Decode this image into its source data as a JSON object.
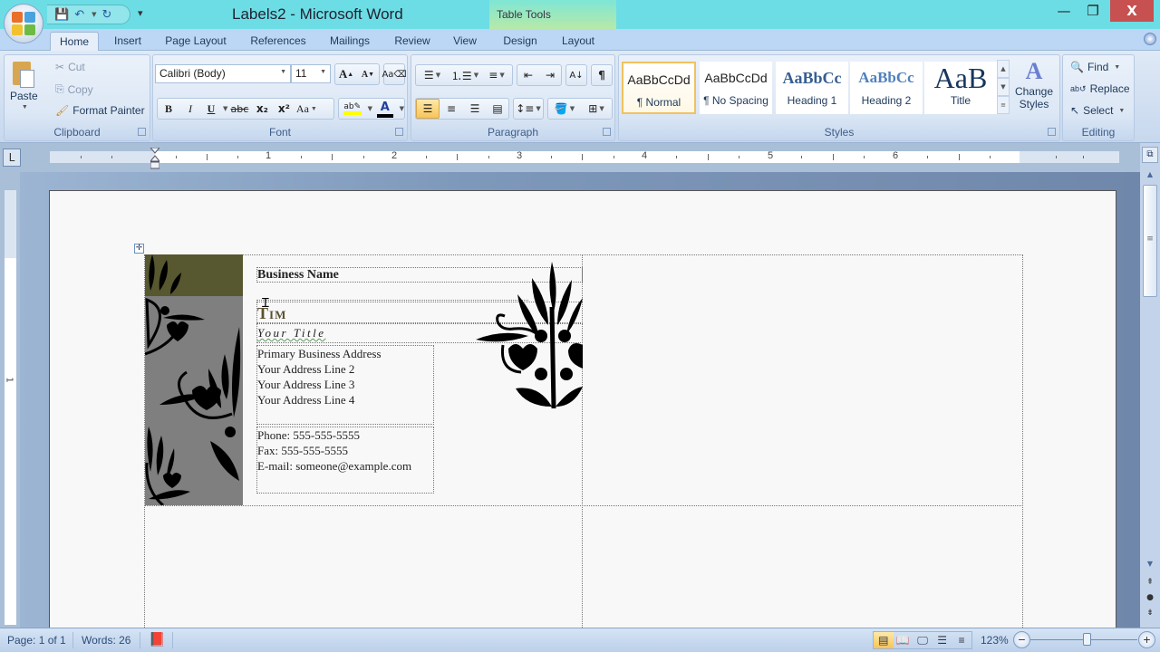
{
  "window": {
    "title": "Labels2 - Microsoft Word",
    "context_tab_group": "Table Tools",
    "minimize_glyph": "—",
    "maximize_glyph": "❐",
    "close_glyph": "X"
  },
  "quick_access": {
    "save_icon": "save-icon",
    "undo_icon": "undo-icon",
    "redo_icon": "redo-icon",
    "customize_glyph": "▾"
  },
  "tabs": [
    {
      "label": "Home",
      "active": true
    },
    {
      "label": "Insert"
    },
    {
      "label": "Page Layout"
    },
    {
      "label": "References"
    },
    {
      "label": "Mailings"
    },
    {
      "label": "Review"
    },
    {
      "label": "View"
    },
    {
      "label": "Design"
    },
    {
      "label": "Layout"
    }
  ],
  "ribbon": {
    "clipboard": {
      "label": "Clipboard",
      "paste": "Paste",
      "cut": "Cut",
      "copy": "Copy",
      "format_painter": "Format Painter"
    },
    "font": {
      "label": "Font",
      "font_name": "Calibri (Body)",
      "font_size": "11",
      "grow_font": "A",
      "shrink_font": "A",
      "bold": "B",
      "italic": "I",
      "underline": "U",
      "strikethrough": "abc",
      "subscript": "x₂",
      "superscript": "x²",
      "change_case": "Aa",
      "highlight_color": "#ffff00",
      "font_color": "#000000"
    },
    "paragraph": {
      "label": "Paragraph",
      "alignment_selected": "left",
      "show_marks": "¶"
    },
    "styles": {
      "label": "Styles",
      "items": [
        {
          "sample": "AaBbCcDd",
          "name": "¶ Normal",
          "selected": true
        },
        {
          "sample": "AaBbCcDd",
          "name": "¶ No Spacing"
        },
        {
          "sample": "AaBbCc",
          "name": "Heading 1"
        },
        {
          "sample": "AaBbCc",
          "name": "Heading 2"
        },
        {
          "sample": "AaB",
          "name": "Title"
        }
      ],
      "change_styles": "Change Styles"
    },
    "editing": {
      "label": "Editing",
      "find": "Find",
      "replace": "Replace",
      "select": "Select"
    }
  },
  "ruler": {
    "tab_selector": "L",
    "numbers": [
      "1",
      "2",
      "3",
      "4",
      "5",
      "6"
    ],
    "vertical_numbers": [
      "1"
    ]
  },
  "document": {
    "business_name": "Business Name",
    "person_name": "Tim",
    "your_title": "Your Title",
    "address_lines": [
      "Primary Business Address",
      "Your Address Line 2",
      "Your Address Line 3",
      "Your Address Line 4"
    ],
    "contact_lines": [
      "Phone: 555-555-5555",
      "Fax: 555-555-5555",
      "E-mail: someone@example.com"
    ],
    "side_band_color": "#575730",
    "side_panel_color": "#7f7f7f"
  },
  "status": {
    "page": "Page: 1 of 1",
    "words": "Words: 26",
    "zoom": "123%",
    "zoom_value_percent": 123
  }
}
